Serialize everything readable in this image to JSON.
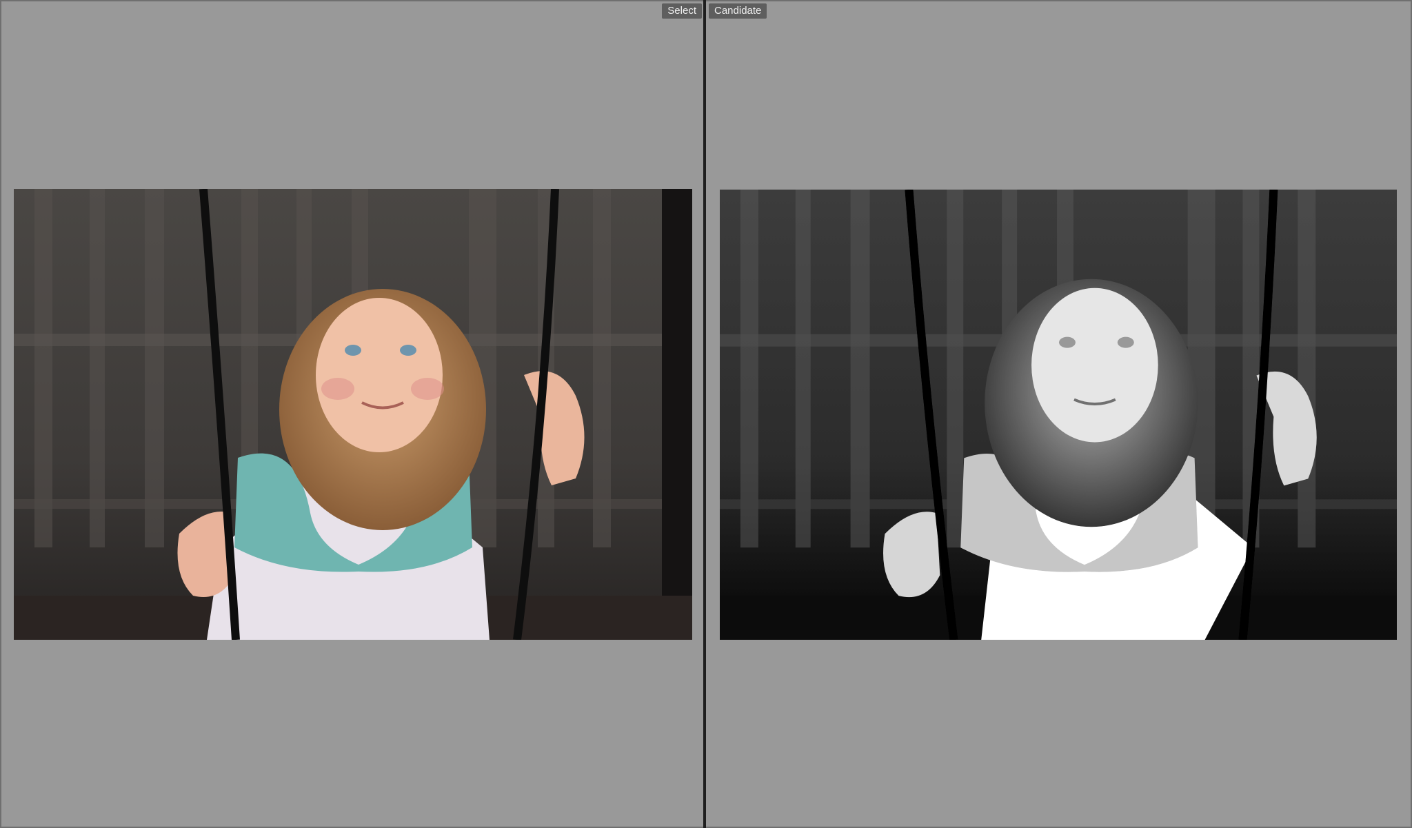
{
  "compare": {
    "select_label": "Select",
    "candidate_label": "Candidate"
  },
  "photos": {
    "select": {
      "variant": "color"
    },
    "candidate": {
      "variant": "black-and-white"
    }
  },
  "colors": {
    "background": "#999999",
    "tag_background": "#5e5e5e",
    "collar": "#6fb5b0"
  }
}
